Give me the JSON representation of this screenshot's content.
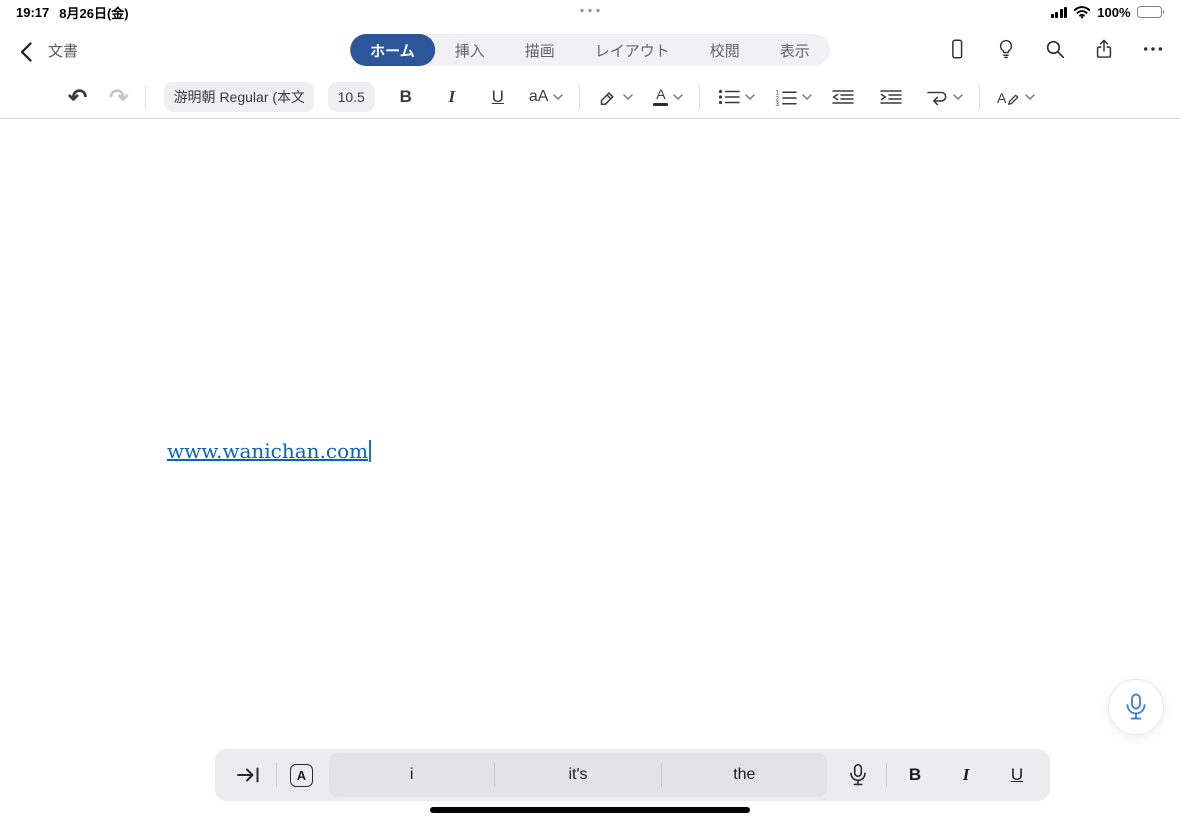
{
  "status_bar": {
    "time": "19:17",
    "date": "8月26日(金)",
    "battery_percent": "100%"
  },
  "nav_bar": {
    "document_title": "文書",
    "tabs": [
      {
        "label": "ホーム",
        "active": true
      },
      {
        "label": "挿入",
        "active": false
      },
      {
        "label": "描画",
        "active": false
      },
      {
        "label": "レイアウト",
        "active": false
      },
      {
        "label": "校閲",
        "active": false
      },
      {
        "label": "表示",
        "active": false
      }
    ]
  },
  "ribbon": {
    "font_name": "游明朝 Regular (本文",
    "font_size": "10.5",
    "bold": "B",
    "italic": "I",
    "underline": "U",
    "grow_shrink": "aA",
    "font_color_letter": "A",
    "style_letter": "A"
  },
  "document": {
    "hyperlink_text": "www.wanichan.com"
  },
  "keyboard_bar": {
    "input_mode": "A",
    "suggestions": [
      "i",
      "it's",
      "the"
    ],
    "bold": "B",
    "italic": "I",
    "underline": "U"
  },
  "icons": {
    "undo": "↶",
    "redo": "↷",
    "n1": "1",
    "n2": "2",
    "n3": "3"
  },
  "colors": {
    "tab_active": "#2b579a",
    "hyperlink": "#0563c1"
  }
}
